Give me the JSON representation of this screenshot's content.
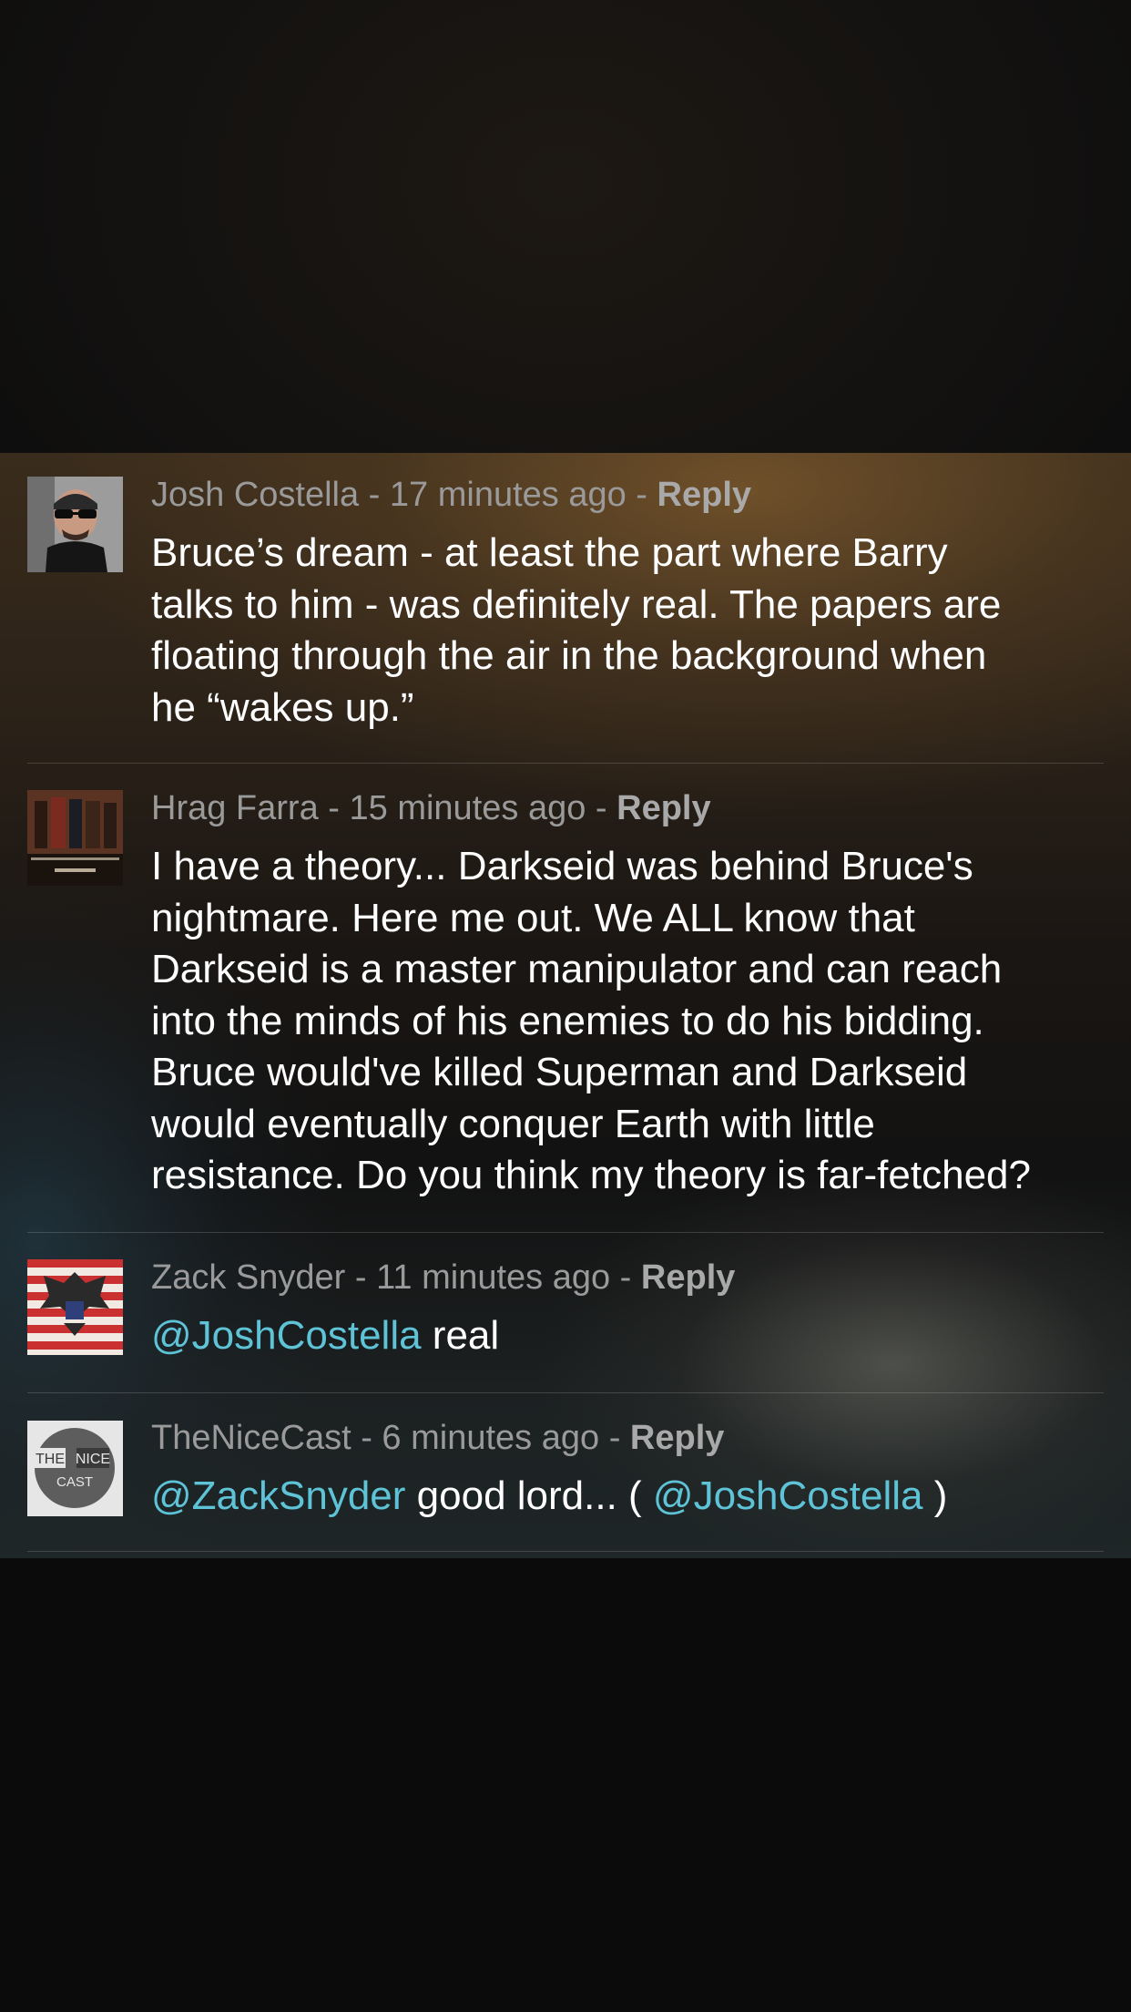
{
  "comments": [
    {
      "author": "Josh Costella",
      "time": "17 minutes ago",
      "reply_label": "Reply",
      "lines": [
        "Bruce’s dream - at least the part where Barry",
        "talks to him - was definitely real. The papers are",
        "floating through the air in the background when",
        "he “wakes up.”"
      ]
    },
    {
      "author": "Hrag Farra",
      "time": "15 minutes ago",
      "reply_label": "Reply",
      "lines": [
        "I have a theory... Darkseid was behind Bruce's",
        "nightmare. Here me out. We ALL know that",
        "Darkseid is a master manipulator and can reach",
        "into the minds of his enemies to do his bidding.",
        "Bruce would've killed Superman and Darkseid",
        "would eventually conquer Earth with little",
        "resistance. Do you think my theory is far-fetched?"
      ]
    },
    {
      "author": "Zack Snyder",
      "time": "11 minutes ago",
      "reply_label": "Reply",
      "mention": "@JoshCostella",
      "text_after": " real"
    },
    {
      "author": "TheNiceCast",
      "time": "6 minutes ago",
      "reply_label": "Reply",
      "mention_1": "@ZackSnyder",
      "text_middle": " good lord... ( ",
      "mention_2": "@JoshCostella",
      "text_end": " )"
    }
  ],
  "avatars": {
    "nice_cast_logo_text": [
      "THE",
      "NICE",
      "CAST"
    ]
  },
  "separator": " - "
}
